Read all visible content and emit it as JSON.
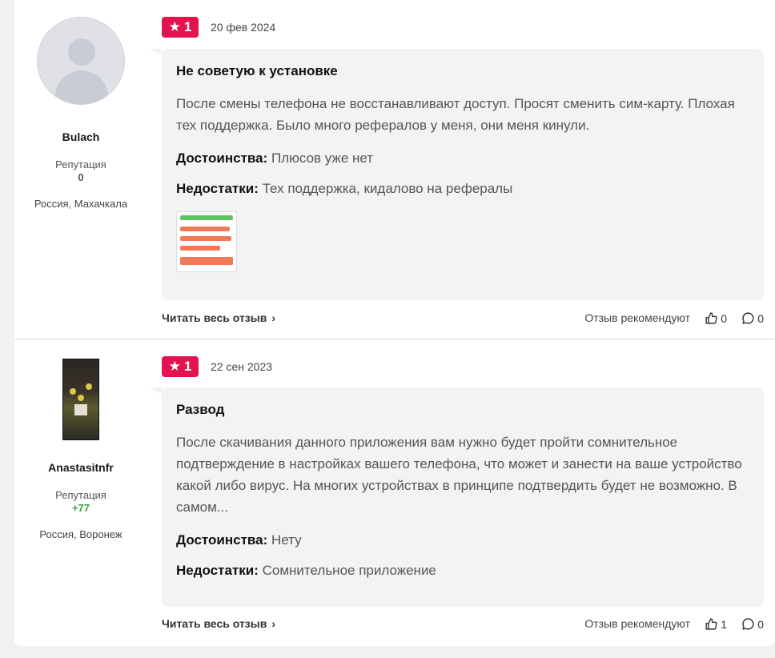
{
  "reviews": [
    {
      "author": {
        "name": "Bulach",
        "reputation_label": "Репутация",
        "reputation": "0",
        "location": "Россия, Махачкала"
      },
      "rating": "1",
      "date": "20 фев 2024",
      "title": "Не советую к установке",
      "text": "После смены телефона не восстанавливают доступ. Просят сменить сим-карту. Плохая тех поддержка. Было много рефералов у меня, они меня кинули.",
      "pros_label": "Достоинства:",
      "pros": "Плюсов уже нет",
      "cons_label": "Недостатки:",
      "cons": "Тех поддержка, кидалово на рефералы",
      "read_more": "Читать весь отзыв",
      "recommend_label": "Отзыв рекомендуют",
      "likes": "0",
      "comments": "0"
    },
    {
      "author": {
        "name": "Anastasitnfr",
        "reputation_label": "Репутация",
        "reputation": "+77",
        "location": "Россия, Воронеж"
      },
      "rating": "1",
      "date": "22 сен 2023",
      "title": "Развод",
      "text": "После скачивания данного приложения вам нужно будет пройти сомнительное подтверждение в настройках вашего телефона, что может и занести на ваше устройство какой либо вирус. На многих устройствах в принципе подтвердить будет не возможно. В самом...",
      "pros_label": "Достоинства:",
      "pros": "Нету",
      "cons_label": "Недостатки:",
      "cons": "Сомнительное приложение",
      "read_more": "Читать весь отзыв",
      "recommend_label": "Отзыв рекомендуют",
      "likes": "1",
      "comments": "0"
    }
  ],
  "icons": {
    "star": "star-icon",
    "like": "thumbs-up-icon",
    "comment": "comment-icon",
    "chevron": "chevron-right-icon"
  },
  "colors": {
    "rating_badge": "#e4134f",
    "positive_reputation": "#2eaa3f",
    "bubble_bg": "#f2f3f5"
  }
}
